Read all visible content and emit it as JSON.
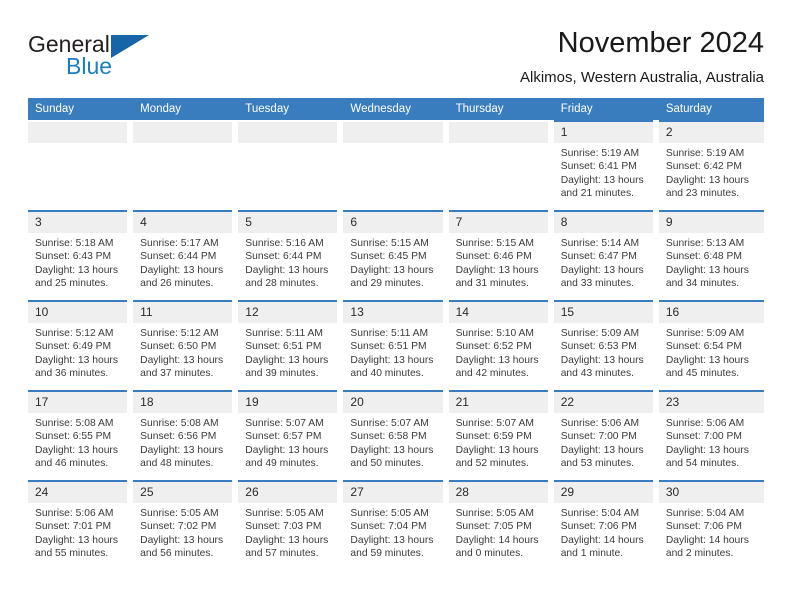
{
  "brand": {
    "name_part1": "General",
    "name_part2": "Blue",
    "triangle_color": "#1565a8",
    "blue_text_color": "#1a7fc1"
  },
  "header": {
    "title": "November 2024",
    "location": "Alkimos, Western Australia, Australia"
  },
  "theme": {
    "header_row_background": "#3a7dbf",
    "header_row_text": "#ffffff",
    "daynum_background": "#efefef",
    "cell_top_border": "#3a7dbf",
    "body_text": "#3b3b3b"
  },
  "weekdays": [
    "Sunday",
    "Monday",
    "Tuesday",
    "Wednesday",
    "Thursday",
    "Friday",
    "Saturday"
  ],
  "labels": {
    "sunrise_prefix": "Sunrise: ",
    "sunset_prefix": "Sunset: ",
    "daylight_prefix": "Daylight: "
  },
  "weeks": [
    [
      {
        "day": "",
        "sunrise": "",
        "sunset": "",
        "daylight": "",
        "empty": true
      },
      {
        "day": "",
        "sunrise": "",
        "sunset": "",
        "daylight": "",
        "empty": true
      },
      {
        "day": "",
        "sunrise": "",
        "sunset": "",
        "daylight": "",
        "empty": true
      },
      {
        "day": "",
        "sunrise": "",
        "sunset": "",
        "daylight": "",
        "empty": true
      },
      {
        "day": "",
        "sunrise": "",
        "sunset": "",
        "daylight": "",
        "empty": true
      },
      {
        "day": "1",
        "sunrise": "Sunrise: 5:19 AM",
        "sunset": "Sunset: 6:41 PM",
        "daylight": "Daylight: 13 hours and 21 minutes.",
        "empty": false
      },
      {
        "day": "2",
        "sunrise": "Sunrise: 5:19 AM",
        "sunset": "Sunset: 6:42 PM",
        "daylight": "Daylight: 13 hours and 23 minutes.",
        "empty": false
      }
    ],
    [
      {
        "day": "3",
        "sunrise": "Sunrise: 5:18 AM",
        "sunset": "Sunset: 6:43 PM",
        "daylight": "Daylight: 13 hours and 25 minutes.",
        "empty": false
      },
      {
        "day": "4",
        "sunrise": "Sunrise: 5:17 AM",
        "sunset": "Sunset: 6:44 PM",
        "daylight": "Daylight: 13 hours and 26 minutes.",
        "empty": false
      },
      {
        "day": "5",
        "sunrise": "Sunrise: 5:16 AM",
        "sunset": "Sunset: 6:44 PM",
        "daylight": "Daylight: 13 hours and 28 minutes.",
        "empty": false
      },
      {
        "day": "6",
        "sunrise": "Sunrise: 5:15 AM",
        "sunset": "Sunset: 6:45 PM",
        "daylight": "Daylight: 13 hours and 29 minutes.",
        "empty": false
      },
      {
        "day": "7",
        "sunrise": "Sunrise: 5:15 AM",
        "sunset": "Sunset: 6:46 PM",
        "daylight": "Daylight: 13 hours and 31 minutes.",
        "empty": false
      },
      {
        "day": "8",
        "sunrise": "Sunrise: 5:14 AM",
        "sunset": "Sunset: 6:47 PM",
        "daylight": "Daylight: 13 hours and 33 minutes.",
        "empty": false
      },
      {
        "day": "9",
        "sunrise": "Sunrise: 5:13 AM",
        "sunset": "Sunset: 6:48 PM",
        "daylight": "Daylight: 13 hours and 34 minutes.",
        "empty": false
      }
    ],
    [
      {
        "day": "10",
        "sunrise": "Sunrise: 5:12 AM",
        "sunset": "Sunset: 6:49 PM",
        "daylight": "Daylight: 13 hours and 36 minutes.",
        "empty": false
      },
      {
        "day": "11",
        "sunrise": "Sunrise: 5:12 AM",
        "sunset": "Sunset: 6:50 PM",
        "daylight": "Daylight: 13 hours and 37 minutes.",
        "empty": false
      },
      {
        "day": "12",
        "sunrise": "Sunrise: 5:11 AM",
        "sunset": "Sunset: 6:51 PM",
        "daylight": "Daylight: 13 hours and 39 minutes.",
        "empty": false
      },
      {
        "day": "13",
        "sunrise": "Sunrise: 5:11 AM",
        "sunset": "Sunset: 6:51 PM",
        "daylight": "Daylight: 13 hours and 40 minutes.",
        "empty": false
      },
      {
        "day": "14",
        "sunrise": "Sunrise: 5:10 AM",
        "sunset": "Sunset: 6:52 PM",
        "daylight": "Daylight: 13 hours and 42 minutes.",
        "empty": false
      },
      {
        "day": "15",
        "sunrise": "Sunrise: 5:09 AM",
        "sunset": "Sunset: 6:53 PM",
        "daylight": "Daylight: 13 hours and 43 minutes.",
        "empty": false
      },
      {
        "day": "16",
        "sunrise": "Sunrise: 5:09 AM",
        "sunset": "Sunset: 6:54 PM",
        "daylight": "Daylight: 13 hours and 45 minutes.",
        "empty": false
      }
    ],
    [
      {
        "day": "17",
        "sunrise": "Sunrise: 5:08 AM",
        "sunset": "Sunset: 6:55 PM",
        "daylight": "Daylight: 13 hours and 46 minutes.",
        "empty": false
      },
      {
        "day": "18",
        "sunrise": "Sunrise: 5:08 AM",
        "sunset": "Sunset: 6:56 PM",
        "daylight": "Daylight: 13 hours and 48 minutes.",
        "empty": false
      },
      {
        "day": "19",
        "sunrise": "Sunrise: 5:07 AM",
        "sunset": "Sunset: 6:57 PM",
        "daylight": "Daylight: 13 hours and 49 minutes.",
        "empty": false
      },
      {
        "day": "20",
        "sunrise": "Sunrise: 5:07 AM",
        "sunset": "Sunset: 6:58 PM",
        "daylight": "Daylight: 13 hours and 50 minutes.",
        "empty": false
      },
      {
        "day": "21",
        "sunrise": "Sunrise: 5:07 AM",
        "sunset": "Sunset: 6:59 PM",
        "daylight": "Daylight: 13 hours and 52 minutes.",
        "empty": false
      },
      {
        "day": "22",
        "sunrise": "Sunrise: 5:06 AM",
        "sunset": "Sunset: 7:00 PM",
        "daylight": "Daylight: 13 hours and 53 minutes.",
        "empty": false
      },
      {
        "day": "23",
        "sunrise": "Sunrise: 5:06 AM",
        "sunset": "Sunset: 7:00 PM",
        "daylight": "Daylight: 13 hours and 54 minutes.",
        "empty": false
      }
    ],
    [
      {
        "day": "24",
        "sunrise": "Sunrise: 5:06 AM",
        "sunset": "Sunset: 7:01 PM",
        "daylight": "Daylight: 13 hours and 55 minutes.",
        "empty": false
      },
      {
        "day": "25",
        "sunrise": "Sunrise: 5:05 AM",
        "sunset": "Sunset: 7:02 PM",
        "daylight": "Daylight: 13 hours and 56 minutes.",
        "empty": false
      },
      {
        "day": "26",
        "sunrise": "Sunrise: 5:05 AM",
        "sunset": "Sunset: 7:03 PM",
        "daylight": "Daylight: 13 hours and 57 minutes.",
        "empty": false
      },
      {
        "day": "27",
        "sunrise": "Sunrise: 5:05 AM",
        "sunset": "Sunset: 7:04 PM",
        "daylight": "Daylight: 13 hours and 59 minutes.",
        "empty": false
      },
      {
        "day": "28",
        "sunrise": "Sunrise: 5:05 AM",
        "sunset": "Sunset: 7:05 PM",
        "daylight": "Daylight: 14 hours and 0 minutes.",
        "empty": false
      },
      {
        "day": "29",
        "sunrise": "Sunrise: 5:04 AM",
        "sunset": "Sunset: 7:06 PM",
        "daylight": "Daylight: 14 hours and 1 minute.",
        "empty": false
      },
      {
        "day": "30",
        "sunrise": "Sunrise: 5:04 AM",
        "sunset": "Sunset: 7:06 PM",
        "daylight": "Daylight: 14 hours and 2 minutes.",
        "empty": false
      }
    ]
  ]
}
